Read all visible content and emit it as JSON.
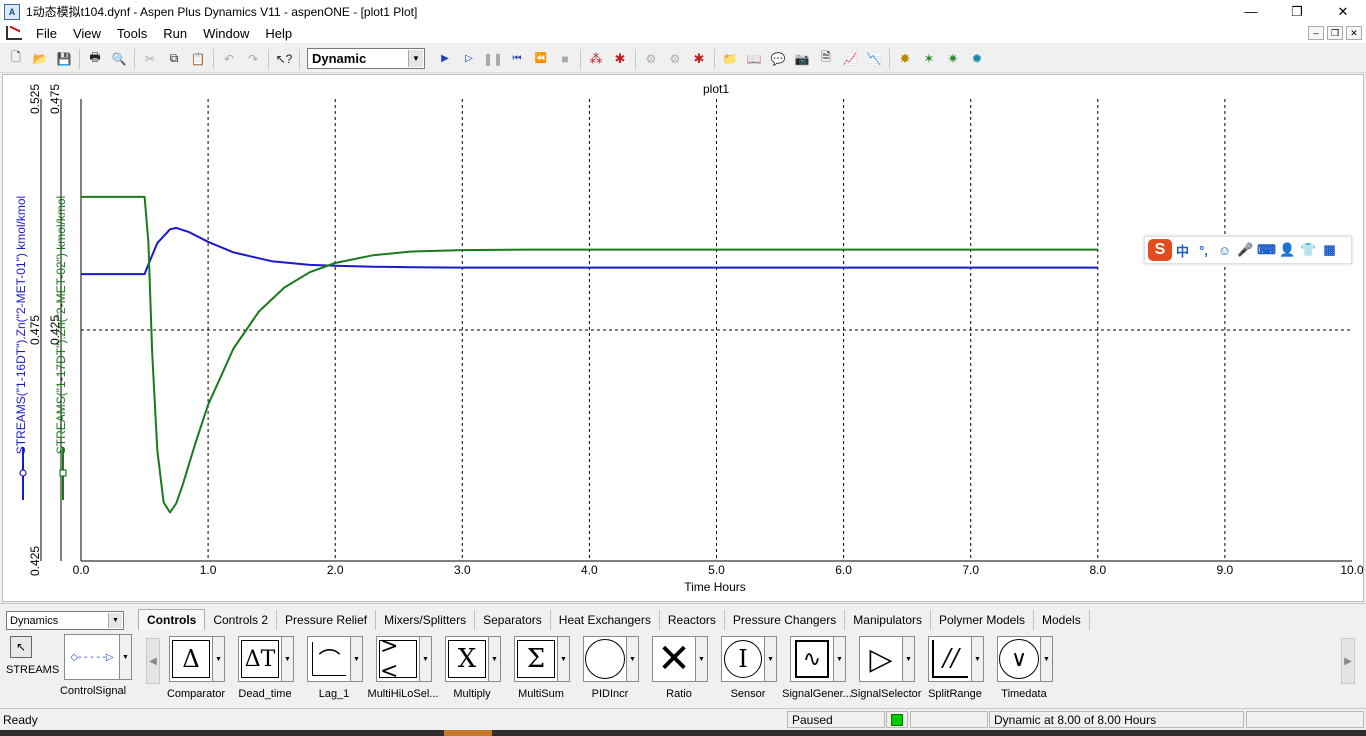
{
  "window": {
    "title": "1动态模拟t104.dynf - Aspen Plus Dynamics V11 - aspenONE - [plot1 Plot]",
    "app_icon": "A",
    "minimize": "—",
    "restore": "❐",
    "close": "✕"
  },
  "menu": {
    "items": [
      "File",
      "View",
      "Tools",
      "Run",
      "Window",
      "Help"
    ]
  },
  "toolbar": {
    "mode": "Dynamic"
  },
  "chart_data": {
    "type": "line",
    "title": "plot1",
    "xlabel": "Time Hours",
    "xlim": [
      0,
      10
    ],
    "xticks": [
      "0.0",
      "1.0",
      "2.0",
      "3.0",
      "4.0",
      "5.0",
      "6.0",
      "7.0",
      "8.0",
      "9.0",
      "10.0"
    ],
    "grid": "dashed",
    "axes": [
      {
        "label": "STREAMS(\"1-16DT\").Zn(\"2-MET-01\") kmol/kmol",
        "color": "#1a1acc",
        "ylim": [
          0.425,
          0.525
        ],
        "ticks": [
          "0.525",
          "0.475",
          "0.425"
        ]
      },
      {
        "label": "STREAMS(\"1-17DT\").Zn(\"2-MET-02\") kmol/kmol",
        "color": "#1a7a1a",
        "ylim": [
          0.375,
          0.475
        ],
        "ticks": [
          "0.475",
          "0.425"
        ]
      }
    ],
    "series": [
      {
        "name": "STREAMS(\"1-16DT\").Zn(\"2-MET-01\")",
        "color": "#1a1acc",
        "axis": 0,
        "x": [
          0,
          0.5,
          0.53,
          0.6,
          0.7,
          0.75,
          0.85,
          1.0,
          1.2,
          1.5,
          1.8,
          2.0,
          2.3,
          2.6,
          3.0,
          3.5,
          4.0,
          5.0,
          6.0,
          7.0,
          8.0
        ],
        "y": [
          0.4871,
          0.4871,
          0.4892,
          0.4938,
          0.4968,
          0.4971,
          0.4962,
          0.4941,
          0.4918,
          0.4899,
          0.4891,
          0.4889,
          0.4887,
          0.4886,
          0.4885,
          0.4885,
          0.4885,
          0.4885,
          0.4885,
          0.4885,
          0.4885
        ]
      },
      {
        "name": "STREAMS(\"1-17DT\").Zn(\"2-MET-02\")",
        "color": "#1a7a1a",
        "axis": 1,
        "x": [
          0,
          0.5,
          0.53,
          0.56,
          0.6,
          0.65,
          0.7,
          0.75,
          0.8,
          0.9,
          1.0,
          1.2,
          1.4,
          1.6,
          1.8,
          2.0,
          2.3,
          2.6,
          3.0,
          3.5,
          4.0,
          5.0,
          6.0,
          7.0,
          8.0
        ],
        "y": [
          0.4538,
          0.4538,
          0.444,
          0.42,
          0.399,
          0.3877,
          0.3855,
          0.3875,
          0.3915,
          0.4005,
          0.4088,
          0.421,
          0.429,
          0.4342,
          0.4375,
          0.4395,
          0.4412,
          0.442,
          0.4423,
          0.4424,
          0.4424,
          0.4424,
          0.4424,
          0.4424,
          0.4424
        ]
      }
    ]
  },
  "ime": {
    "logo": "S",
    "items": [
      "中",
      "°,",
      "☺",
      "🎤",
      "⌨",
      "👤",
      "👕",
      "▦"
    ]
  },
  "palette": {
    "library": "Dynamics",
    "tabs": [
      "Controls",
      "Controls 2",
      "Pressure Relief",
      "Mixers/Splitters",
      "Separators",
      "Heat Exchangers",
      "Reactors",
      "Pressure Changers",
      "Manipulators",
      "Polymer Models",
      "Models"
    ],
    "streams_label": "STREAMS",
    "control_signal_label": "ControlSignal",
    "models": [
      {
        "label": "Comparator",
        "glyph": "Δ"
      },
      {
        "label": "Dead_time",
        "glyph": "ΔT"
      },
      {
        "label": "Lag_1",
        "glyph": "⟋"
      },
      {
        "label": "MultiHiLoSel...",
        "glyph": "><"
      },
      {
        "label": "Multiply",
        "glyph": "X"
      },
      {
        "label": "MultiSum",
        "glyph": "Σ"
      },
      {
        "label": "PIDIncr",
        "glyph": "○"
      },
      {
        "label": "Ratio",
        "glyph": "✕"
      },
      {
        "label": "Sensor",
        "glyph": "I"
      },
      {
        "label": "SignalGener...",
        "glyph": "∿"
      },
      {
        "label": "SignalSelector",
        "glyph": "▷"
      },
      {
        "label": "SplitRange",
        "glyph": "//"
      },
      {
        "label": "Timedata",
        "glyph": "◷"
      }
    ]
  },
  "status": {
    "ready": "Ready",
    "state": "Paused",
    "indicator_color": "#00cc00",
    "progress": "Dynamic at 8.00 of 8.00 Hours"
  }
}
